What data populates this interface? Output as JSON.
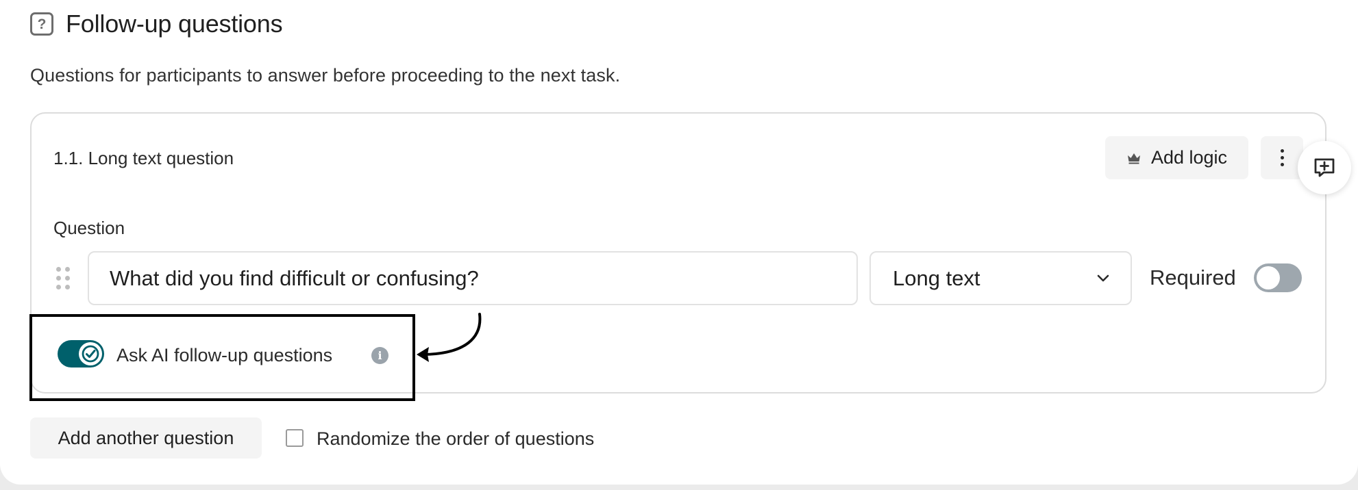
{
  "section": {
    "icon": "question-square-icon",
    "title": "Follow-up questions",
    "description": "Questions for participants to answer before proceeding to the next task."
  },
  "question_card": {
    "title": "1.1. Long text question",
    "add_logic_label": "Add logic",
    "add_logic_icon": "crown-icon",
    "more_icon": "more-vertical-icon",
    "question_label": "Question",
    "question_value": "What did you find difficult or confusing?",
    "type_selected": "Long text",
    "required_label": "Required",
    "required_on": false,
    "ai_followup_label": "Ask AI follow-up questions",
    "ai_followup_on": true
  },
  "footer": {
    "add_question_label": "Add another question",
    "randomize_label": "Randomize the order of questions",
    "randomize_checked": false
  },
  "colors": {
    "toggle_on": "#00606b",
    "toggle_off": "#9ea7ae",
    "info_icon": "#9aa3ab"
  }
}
